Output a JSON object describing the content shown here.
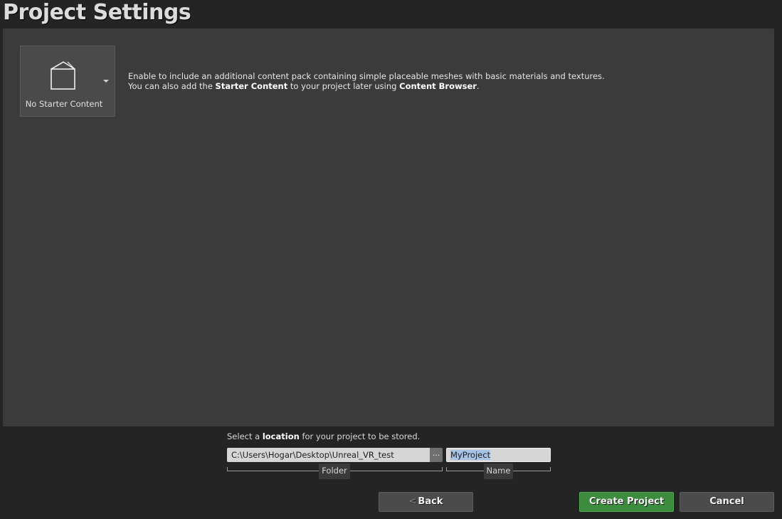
{
  "page": {
    "title": "Project Settings"
  },
  "starter_content": {
    "label": "No Starter Content",
    "icon": "cube-outline-icon",
    "description_line1": "Enable to include an additional content pack containing simple placeable meshes with basic materials and textures.",
    "description_line2_pre": "You can also add the ",
    "description_line2_bold1": "Starter Content",
    "description_line2_mid": " to your project later using ",
    "description_line2_bold2": "Content Browser",
    "description_line2_post": "."
  },
  "location": {
    "hint_pre": "Select a ",
    "hint_bold": "location",
    "hint_post": " for your project to be stored.",
    "folder_value": "C:\\Users\\Hogar\\Desktop\\Unreal_VR_test",
    "browse_label": "...",
    "folder_caption": "Folder",
    "name_value": "MyProject",
    "name_caption": "Name"
  },
  "buttons": {
    "back_chevron": "<",
    "back_label": "Back",
    "create_label": "Create Project",
    "cancel_label": "Cancel"
  },
  "colors": {
    "background": "#242424",
    "panel": "#3b3b3b",
    "create_button": "#3d8c3d",
    "neutral_button": "#4b4b4b",
    "selection": "#a7c3e6"
  }
}
